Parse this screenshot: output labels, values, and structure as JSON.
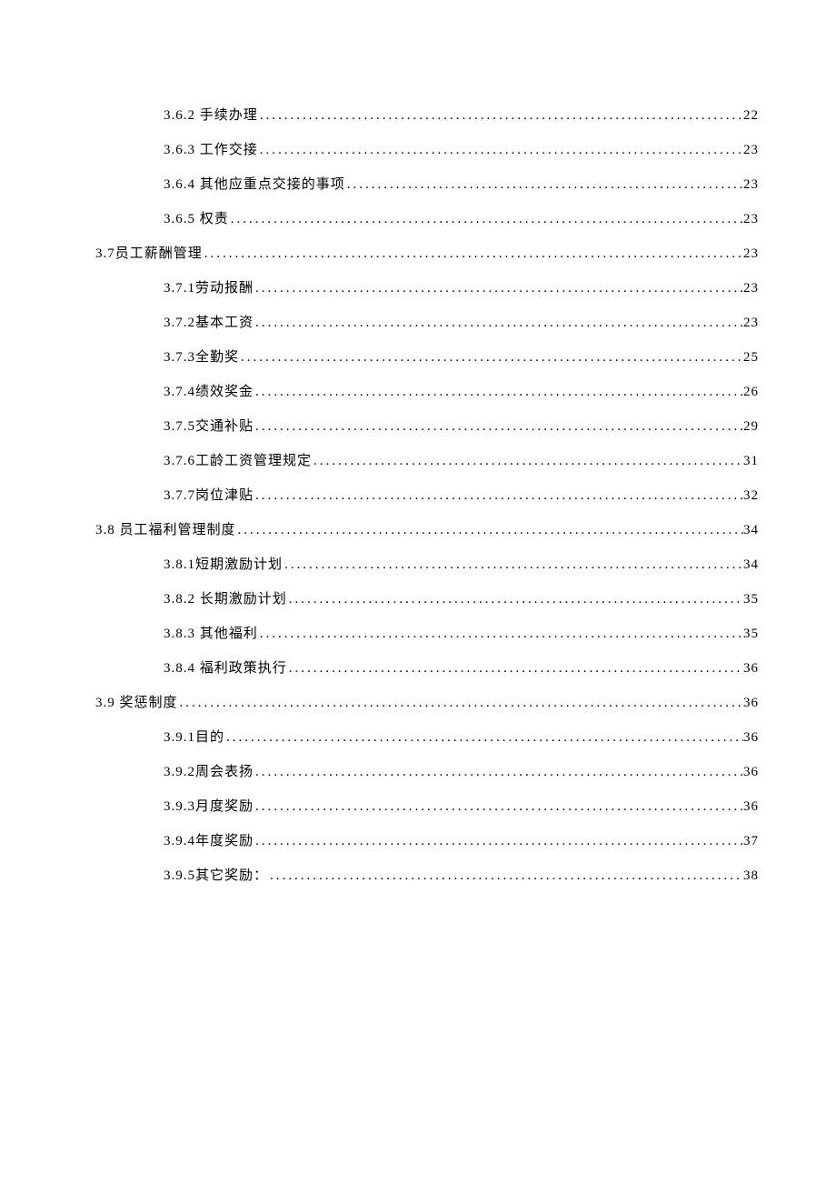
{
  "toc": [
    {
      "level": 2,
      "label": "3.6.2 手续办理",
      "page": "22"
    },
    {
      "level": 2,
      "label": "3.6.3 工作交接",
      "page": "23"
    },
    {
      "level": 2,
      "label": "3.6.4 其他应重点交接的事项",
      "page": "23"
    },
    {
      "level": 2,
      "label": "3.6.5 权责",
      "page": "23"
    },
    {
      "level": 1,
      "label": "3.7员工薪酬管理",
      "page": "23"
    },
    {
      "level": 2,
      "label": "3.7.1劳动报酬",
      "page": "23"
    },
    {
      "level": 2,
      "label": "3.7.2基本工资",
      "page": "23"
    },
    {
      "level": 2,
      "label": "3.7.3全勤奖",
      "page": "25"
    },
    {
      "level": 2,
      "label": "3.7.4绩效奖金",
      "page": "26"
    },
    {
      "level": 2,
      "label": "3.7.5交通补贴",
      "page": "29"
    },
    {
      "level": 2,
      "label": "3.7.6工龄工资管理规定",
      "page": "31"
    },
    {
      "level": 2,
      "label": "3.7.7岗位津贴",
      "page": "32"
    },
    {
      "level": 1,
      "label": "3.8 员工福利管理制度",
      "page": "34"
    },
    {
      "level": 2,
      "label": "3.8.1短期激励计划",
      "page": "34"
    },
    {
      "level": 2,
      "label": "3.8.2 长期激励计划",
      "page": "35"
    },
    {
      "level": 2,
      "label": "3.8.3 其他福利",
      "page": "35"
    },
    {
      "level": 2,
      "label": "3.8.4 福利政策执行",
      "page": "36"
    },
    {
      "level": 1,
      "label": "3.9 奖惩制度",
      "page": "36"
    },
    {
      "level": 2,
      "label": "3.9.1目的",
      "page": "36"
    },
    {
      "level": 2,
      "label": "3.9.2周会表扬",
      "page": "36"
    },
    {
      "level": 2,
      "label": "3.9.3月度奖励",
      "page": "36"
    },
    {
      "level": 2,
      "label": "3.9.4年度奖励",
      "page": "37"
    },
    {
      "level": 2,
      "label": "3.9.5其它奖励：",
      "page": "38"
    }
  ]
}
